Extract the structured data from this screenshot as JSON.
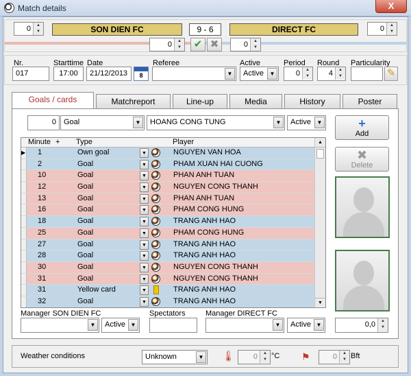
{
  "window": {
    "title": "Match details",
    "close_label": "X"
  },
  "score": {
    "home_points": "0",
    "home_team": "SON DIEN FC",
    "result": "9 - 6",
    "away_team": "DIRECT FC",
    "away_points": "0",
    "home_sub": "0",
    "away_sub": "0",
    "confirm_label": "✔",
    "reject_label": "✖"
  },
  "colors": {
    "home_bar": "#e9b9b1",
    "away_bar": "#bcd2e6",
    "team_gold": "#e0cb74"
  },
  "info": {
    "nr_label": "Nr.",
    "nr_value": "017",
    "start_label": "Starttime",
    "start_value": "17:00",
    "date_label": "Date",
    "date_value": "21/12/2013",
    "date_icon_day": "8",
    "referee_label": "Referee",
    "referee_value": "",
    "active_label": "Active",
    "active_value": "Active",
    "period_label": "Period",
    "period_value": "0",
    "round_label": "Round",
    "round_value": "4",
    "particularity_label": "Particularity"
  },
  "tabs": [
    "Goals / cards",
    "Matchreport",
    "Line-up",
    "Media",
    "History",
    "Poster"
  ],
  "entry": {
    "minute": "0",
    "type": "Goal",
    "player": "HOANG CONG TUNG",
    "status": "Active"
  },
  "buttons": {
    "add": "Add",
    "delete": "Delete"
  },
  "grid": {
    "col_minute": "Minute",
    "col_sort": "+",
    "col_type": "Type",
    "col_player": "Player",
    "rows": [
      {
        "minute": "1",
        "type": "Own goal",
        "player": "NGUYEN VAN HOA",
        "side": "blue",
        "mark": "ball"
      },
      {
        "minute": "2",
        "type": "Goal",
        "player": "PHAM XUAN HAI CUONG",
        "side": "blue",
        "mark": "ball"
      },
      {
        "minute": "10",
        "type": "Goal",
        "player": "PHAN ANH TUAN",
        "side": "pink",
        "mark": "ball"
      },
      {
        "minute": "12",
        "type": "Goal",
        "player": "NGUYEN CONG THANH",
        "side": "pink",
        "mark": "ball"
      },
      {
        "minute": "13",
        "type": "Goal",
        "player": "PHAN ANH TUAN",
        "side": "pink",
        "mark": "ball"
      },
      {
        "minute": "16",
        "type": "Goal",
        "player": "PHAM CONG HUNG",
        "side": "pink",
        "mark": "ball"
      },
      {
        "minute": "18",
        "type": "Goal",
        "player": "TRANG ANH HAO",
        "side": "blue",
        "mark": "ball"
      },
      {
        "minute": "25",
        "type": "Goal",
        "player": "PHAM CONG HUNG",
        "side": "pink",
        "mark": "ball"
      },
      {
        "minute": "27",
        "type": "Goal",
        "player": "TRANG ANH HAO",
        "side": "blue",
        "mark": "ball"
      },
      {
        "minute": "28",
        "type": "Goal",
        "player": "TRANG ANH HAO",
        "side": "blue",
        "mark": "ball"
      },
      {
        "minute": "30",
        "type": "Goal",
        "player": "NGUYEN CONG THANH",
        "side": "pink",
        "mark": "ball"
      },
      {
        "minute": "31",
        "type": "Goal",
        "player": "NGUYEN CONG THANH",
        "side": "pink",
        "mark": "ball"
      },
      {
        "minute": "31",
        "type": "Yellow card",
        "player": "TRANG ANH HAO",
        "side": "blue",
        "mark": "card"
      },
      {
        "minute": "32",
        "type": "Goal",
        "player": "TRANG ANH HAO",
        "side": "blue",
        "mark": "ball"
      }
    ]
  },
  "managers": {
    "home_label": "Manager SON DIEN FC",
    "home_value": "",
    "home_status": "Active",
    "spectators_label": "Spectators",
    "spectators_value": "",
    "away_label": "Manager DIRECT FC",
    "away_value": "",
    "away_status": "Active",
    "rating": "0,0"
  },
  "weather": {
    "label": "Weather conditions",
    "condition": "Unknown",
    "temperature": "0",
    "temp_unit": "°C",
    "wind": "0",
    "wind_unit": "Bft"
  }
}
